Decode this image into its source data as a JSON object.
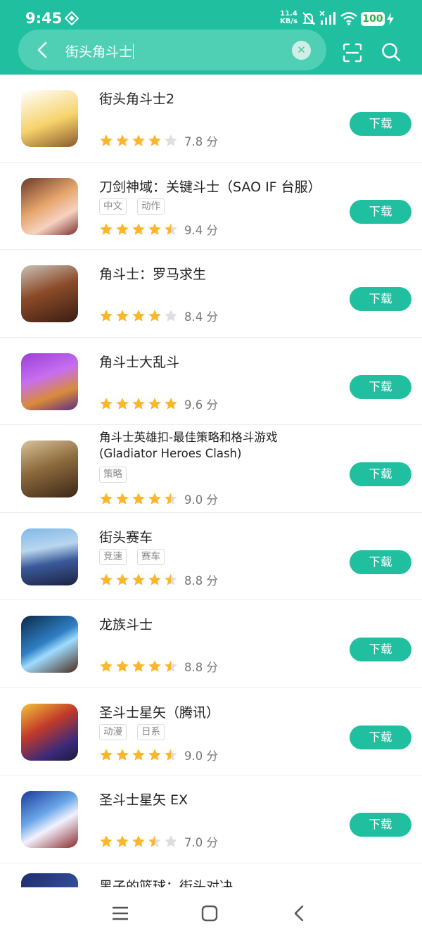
{
  "status_bar": {
    "time": "9:45",
    "net_speed_value": "11.4",
    "net_speed_unit": "KB/s",
    "battery": "100"
  },
  "search": {
    "query": "街头角斗士"
  },
  "download_label": "下载",
  "score_suffix": "分",
  "colors": {
    "accent": "#1fbf9f",
    "star": "#fbb62c",
    "star_empty": "#dedede"
  },
  "results": [
    {
      "title": "街头角斗士2",
      "tags": [],
      "rating": 4.0,
      "score": "7.8",
      "icon": "pixel-gladiator-icon"
    },
    {
      "title": "刀剑神域：关键斗士（SAO IF 台服）",
      "tags": [
        "中文",
        "动作"
      ],
      "rating": 4.5,
      "score": "9.4",
      "icon": "anime-girl-icon"
    },
    {
      "title": "角斗士：罗马求生",
      "tags": [],
      "rating": 4.0,
      "score": "8.4",
      "icon": "roman-warrior-icon"
    },
    {
      "title": "角斗士大乱斗",
      "tags": [],
      "rating": 5.0,
      "score": "9.6",
      "icon": "gladiators-arena-icon"
    },
    {
      "title": "角斗士英雄扣-最佳策略和格斗游戏",
      "title2": "(Gladiator Heroes Clash)",
      "tags": [
        "策略"
      ],
      "rating": 4.5,
      "score": "9.0",
      "icon": "spartan-icon"
    },
    {
      "title": "街头赛车",
      "tags": [
        "竞速",
        "赛车"
      ],
      "rating": 4.5,
      "score": "8.8",
      "icon": "race-car-icon"
    },
    {
      "title": "龙族斗士",
      "tags": [],
      "rating": 4.5,
      "score": "8.8",
      "icon": "dragon-icon"
    },
    {
      "title": "圣斗士星矢（腾讯）",
      "tags": [
        "动漫",
        "日系"
      ],
      "rating": 4.5,
      "score": "9.0",
      "icon": "saint-seiya-icon"
    },
    {
      "title": "圣斗士星矢 EX",
      "tags": [],
      "rating": 3.5,
      "score": "7.0",
      "icon": "saint-seiya-ex-icon"
    }
  ],
  "partial_item": {
    "title": "黑子的篮球：街头对决",
    "icon": "basketball-icon"
  }
}
